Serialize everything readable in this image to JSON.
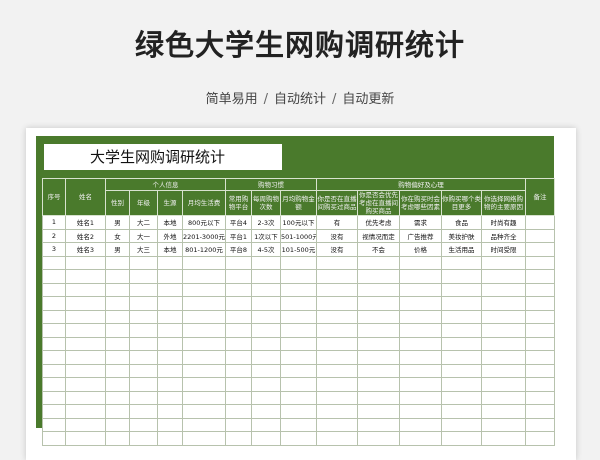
{
  "header": {
    "title": "绿色大学生网购调研统计",
    "tags": [
      "简单易用",
      "自动统计",
      "自动更新"
    ],
    "separator": "/"
  },
  "sheet": {
    "title": "大学生网购调研统计",
    "theme_color": "#4a7a2c",
    "columns_top": {
      "serial": "序号",
      "name": "姓名",
      "personal_info": "个人信息",
      "shopping_habits": "购物习惯",
      "preferences": "购物偏好及心理",
      "remarks": "备注"
    },
    "columns_sub": [
      "性别",
      "年级",
      "生源",
      "月均生活费",
      "常用购物平台",
      "每周购物次数",
      "月均购物金额",
      "你是否在直播间购买过商品",
      "你是否会优先考虑在直播间购买商品",
      "你在购买时会考虑哪些因素",
      "你购买哪个类目更多",
      "你选择网络购物的主要原因"
    ],
    "rows": [
      [
        "1",
        "姓名1",
        "男",
        "大二",
        "本地",
        "800元以下",
        "平台4",
        "2-3次",
        "100元以下",
        "有",
        "优先考虑",
        "需求",
        "食品",
        "时尚有趣",
        ""
      ],
      [
        "2",
        "姓名2",
        "女",
        "大一",
        "外地",
        "2201-3000元",
        "平台1",
        "1次以下",
        "501-1000元",
        "没有",
        "视情况而定",
        "广告推荐",
        "美妆护肤",
        "品种齐全",
        ""
      ],
      [
        "3",
        "姓名3",
        "男",
        "大三",
        "本地",
        "801-1200元",
        "平台8",
        "4-5次",
        "101-500元",
        "没有",
        "不会",
        "价格",
        "生活用品",
        "时间受限",
        ""
      ]
    ],
    "empty_row_count": 14
  }
}
